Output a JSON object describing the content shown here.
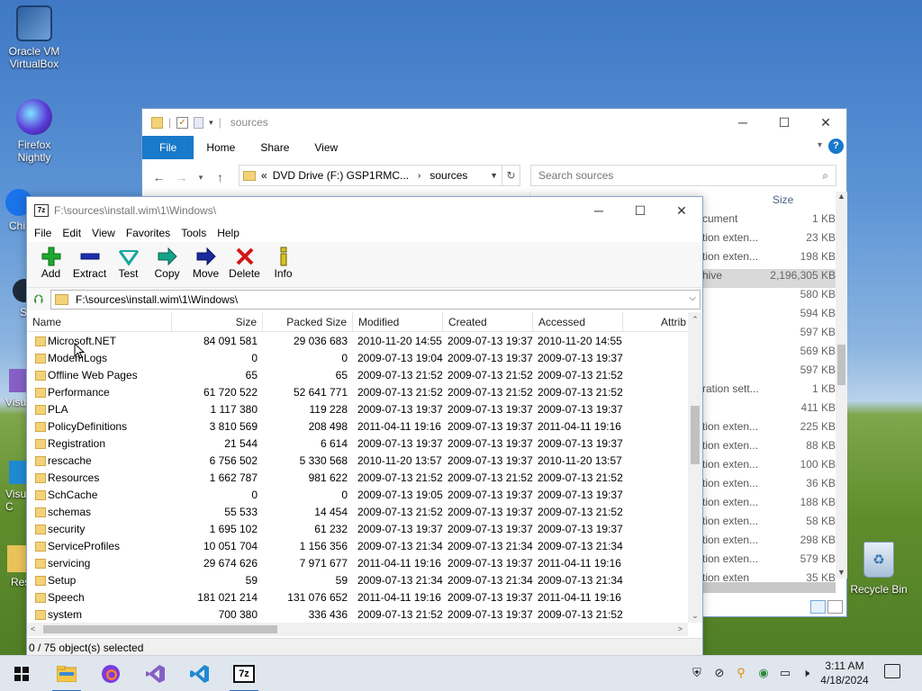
{
  "desktop": {
    "icons": [
      {
        "label": "Oracle VM VirtualBox"
      },
      {
        "label": "Firefox Nightly"
      }
    ],
    "partial_labels": [
      "Chi",
      "S",
      "Visu",
      "Visu C",
      "Res"
    ],
    "recycle_bin": "Recycle Bin"
  },
  "explorer": {
    "title": "sources",
    "ribbon_tabs": [
      "File",
      "Home",
      "Share",
      "View"
    ],
    "address": "DVD Drive (F:) GSP1RMC...",
    "address_prefix": "«",
    "address_current": "sources",
    "search_placeholder": "Search sources",
    "size_header": "Size",
    "rows": [
      {
        "type": "cument",
        "size": "1 KB"
      },
      {
        "type": "tion exten...",
        "size": "23 KB"
      },
      {
        "type": "tion exten...",
        "size": "198 KB"
      },
      {
        "type": "hive",
        "size": "2,196,305 KB"
      },
      {
        "type": "",
        "size": "580 KB"
      },
      {
        "type": "",
        "size": "594 KB"
      },
      {
        "type": "",
        "size": "597 KB"
      },
      {
        "type": "",
        "size": "569 KB"
      },
      {
        "type": "",
        "size": "597 KB"
      },
      {
        "type": "ration sett...",
        "size": "1 KB"
      },
      {
        "type": "",
        "size": "411 KB"
      },
      {
        "type": "tion exten...",
        "size": "225 KB"
      },
      {
        "type": "tion exten...",
        "size": "88 KB"
      },
      {
        "type": "tion exten...",
        "size": "100 KB"
      },
      {
        "type": "tion exten...",
        "size": "36 KB"
      },
      {
        "type": "tion exten...",
        "size": "188 KB"
      },
      {
        "type": "tion exten...",
        "size": "58 KB"
      },
      {
        "type": "tion exten...",
        "size": "298 KB"
      },
      {
        "type": "tion exten...",
        "size": "579 KB"
      },
      {
        "type": "tion exten",
        "size": "35 KB"
      }
    ]
  },
  "zip": {
    "title": "F:\\sources\\install.wim\\1\\Windows\\",
    "menu": [
      "File",
      "Edit",
      "View",
      "Favorites",
      "Tools",
      "Help"
    ],
    "toolbar": [
      {
        "label": "Add",
        "icon": "plus-icon"
      },
      {
        "label": "Extract",
        "icon": "minus-icon"
      },
      {
        "label": "Test",
        "icon": "checkmark-icon"
      },
      {
        "label": "Copy",
        "icon": "copy-arrow-icon"
      },
      {
        "label": "Move",
        "icon": "move-arrow-icon"
      },
      {
        "label": "Delete",
        "icon": "delete-x-icon"
      },
      {
        "label": "Info",
        "icon": "info-icon"
      }
    ],
    "path": "F:\\sources\\install.wim\\1\\Windows\\",
    "columns": [
      "Name",
      "Size",
      "Packed Size",
      "Modified",
      "Created",
      "Accessed",
      "Attrib"
    ],
    "rows": [
      {
        "name": "Microsoft.NET",
        "size": "84 091 581",
        "packed": "29 036 683",
        "modified": "2010-11-20 14:55",
        "created": "2009-07-13 19:37",
        "accessed": "2010-11-20 14:55"
      },
      {
        "name": "ModemLogs",
        "size": "0",
        "packed": "0",
        "modified": "2009-07-13 19:04",
        "created": "2009-07-13 19:37",
        "accessed": "2009-07-13 19:37"
      },
      {
        "name": "Offline Web Pages",
        "size": "65",
        "packed": "65",
        "modified": "2009-07-13 21:52",
        "created": "2009-07-13 21:52",
        "accessed": "2009-07-13 21:52"
      },
      {
        "name": "Performance",
        "size": "61 720 522",
        "packed": "52 641 771",
        "modified": "2009-07-13 21:52",
        "created": "2009-07-13 21:52",
        "accessed": "2009-07-13 21:52"
      },
      {
        "name": "PLA",
        "size": "1 117 380",
        "packed": "119 228",
        "modified": "2009-07-13 19:37",
        "created": "2009-07-13 19:37",
        "accessed": "2009-07-13 19:37"
      },
      {
        "name": "PolicyDefinitions",
        "size": "3 810 569",
        "packed": "208 498",
        "modified": "2011-04-11 19:16",
        "created": "2009-07-13 19:37",
        "accessed": "2011-04-11 19:16"
      },
      {
        "name": "Registration",
        "size": "21 544",
        "packed": "6 614",
        "modified": "2009-07-13 19:37",
        "created": "2009-07-13 19:37",
        "accessed": "2009-07-13 19:37"
      },
      {
        "name": "rescache",
        "size": "6 756 502",
        "packed": "5 330 568",
        "modified": "2010-11-20 13:57",
        "created": "2009-07-13 19:37",
        "accessed": "2010-11-20 13:57"
      },
      {
        "name": "Resources",
        "size": "1 662 787",
        "packed": "981 622",
        "modified": "2009-07-13 21:52",
        "created": "2009-07-13 21:52",
        "accessed": "2009-07-13 21:52"
      },
      {
        "name": "SchCache",
        "size": "0",
        "packed": "0",
        "modified": "2009-07-13 19:05",
        "created": "2009-07-13 19:37",
        "accessed": "2009-07-13 19:37"
      },
      {
        "name": "schemas",
        "size": "55 533",
        "packed": "14 454",
        "modified": "2009-07-13 21:52",
        "created": "2009-07-13 19:37",
        "accessed": "2009-07-13 21:52"
      },
      {
        "name": "security",
        "size": "1 695 102",
        "packed": "61 232",
        "modified": "2009-07-13 19:37",
        "created": "2009-07-13 19:37",
        "accessed": "2009-07-13 19:37"
      },
      {
        "name": "ServiceProfiles",
        "size": "10 051 704",
        "packed": "1 156 356",
        "modified": "2009-07-13 21:34",
        "created": "2009-07-13 21:34",
        "accessed": "2009-07-13 21:34"
      },
      {
        "name": "servicing",
        "size": "29 674 626",
        "packed": "7 971 677",
        "modified": "2011-04-11 19:16",
        "created": "2009-07-13 19:37",
        "accessed": "2011-04-11 19:16"
      },
      {
        "name": "Setup",
        "size": "59",
        "packed": "59",
        "modified": "2009-07-13 21:34",
        "created": "2009-07-13 21:34",
        "accessed": "2009-07-13 21:34"
      },
      {
        "name": "Speech",
        "size": "181 021 214",
        "packed": "131 076 652",
        "modified": "2011-04-11 19:16",
        "created": "2009-07-13 19:37",
        "accessed": "2011-04-11 19:16"
      },
      {
        "name": "system",
        "size": "700 380",
        "packed": "336 436",
        "modified": "2009-07-13 21:52",
        "created": "2009-07-13 19:37",
        "accessed": "2009-07-13 21:52"
      }
    ],
    "status": "0 / 75 object(s) selected"
  },
  "taskbar": {
    "time": "3:11 AM",
    "date": "4/18/2024",
    "apps": [
      "windows-start-icon",
      "file-explorer-icon",
      "firefox-icon",
      "visual-studio-icon",
      "vscode-icon",
      "7zip-icon"
    ]
  },
  "colors": {
    "accent": "#1979ca",
    "folder": "#f3d27a",
    "taskbar": "#dfe6ee"
  }
}
